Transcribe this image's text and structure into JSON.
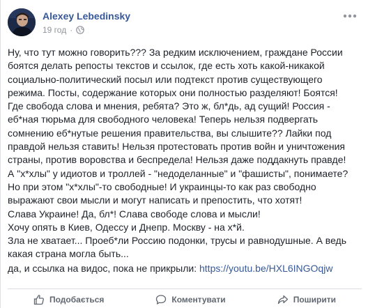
{
  "post": {
    "author": "Alexey Lebedinsky",
    "time": "19 год",
    "privacy_icon": "globe-icon",
    "more_icon": "more-horizontal-icon",
    "body_text": "Ну, что тут можно говорить??? За редким исключением, граждане России\nбоятся делать репосты текстов и ссылок, где есть хоть какой-никакой\nсоциально-политический посыл или подтекст против существующего\nрежима. Посты, содержание которых они полностью разделяют! Боятся!\nГде свобода слова и мнения, ребята? Это ж, бл*дь, ад сущий! Россия -\nеб*ная тюрьма для свободного человека! Теперь нельзя подвергать\nсомнению еб*нутые решения правительства, вы слышите?? Лайки под\nправдой нельзя ставить! Нельзя протестовать против войн и уничтожения\nстраны, против воровства и беспредела! Нельзя даже поддакнуть правде!\nА \"х*хлы\" у идиотов и троллей - \"недоделанные\" и \"фашисты\", понимаете?\nНо при этом \"х*хлы\"-то свободные! И украинцы-то как раз свободно\nвыражают свои мысли и могут написать и препостить, что хотят!\nСлава Украине! Да, бл*! Слава свободе слова и мысли!\nХочу опять в Киев, Одессу и Днепр. Москву - на х*й.\nЗла не хватает... Проеб*ли Россию подонки, трусы и равнодушные. А ведь\nкакая страна могла быть...",
    "link_prefix": "да, и ссылка на видос, пока не прикрыли: ",
    "link_text": "https://youtu.be/HXL6INGOqjw"
  },
  "actions": {
    "like": {
      "label": "Подобається",
      "icon": "thumbs-up-icon"
    },
    "comment": {
      "label": "Коментувати",
      "icon": "comment-icon"
    },
    "share": {
      "label": "Поширити",
      "icon": "share-icon"
    }
  },
  "colors": {
    "author_link": "#365899",
    "text": "#1d2129",
    "meta": "#90949c",
    "action_text": "#606770",
    "divider": "#dadde1"
  }
}
